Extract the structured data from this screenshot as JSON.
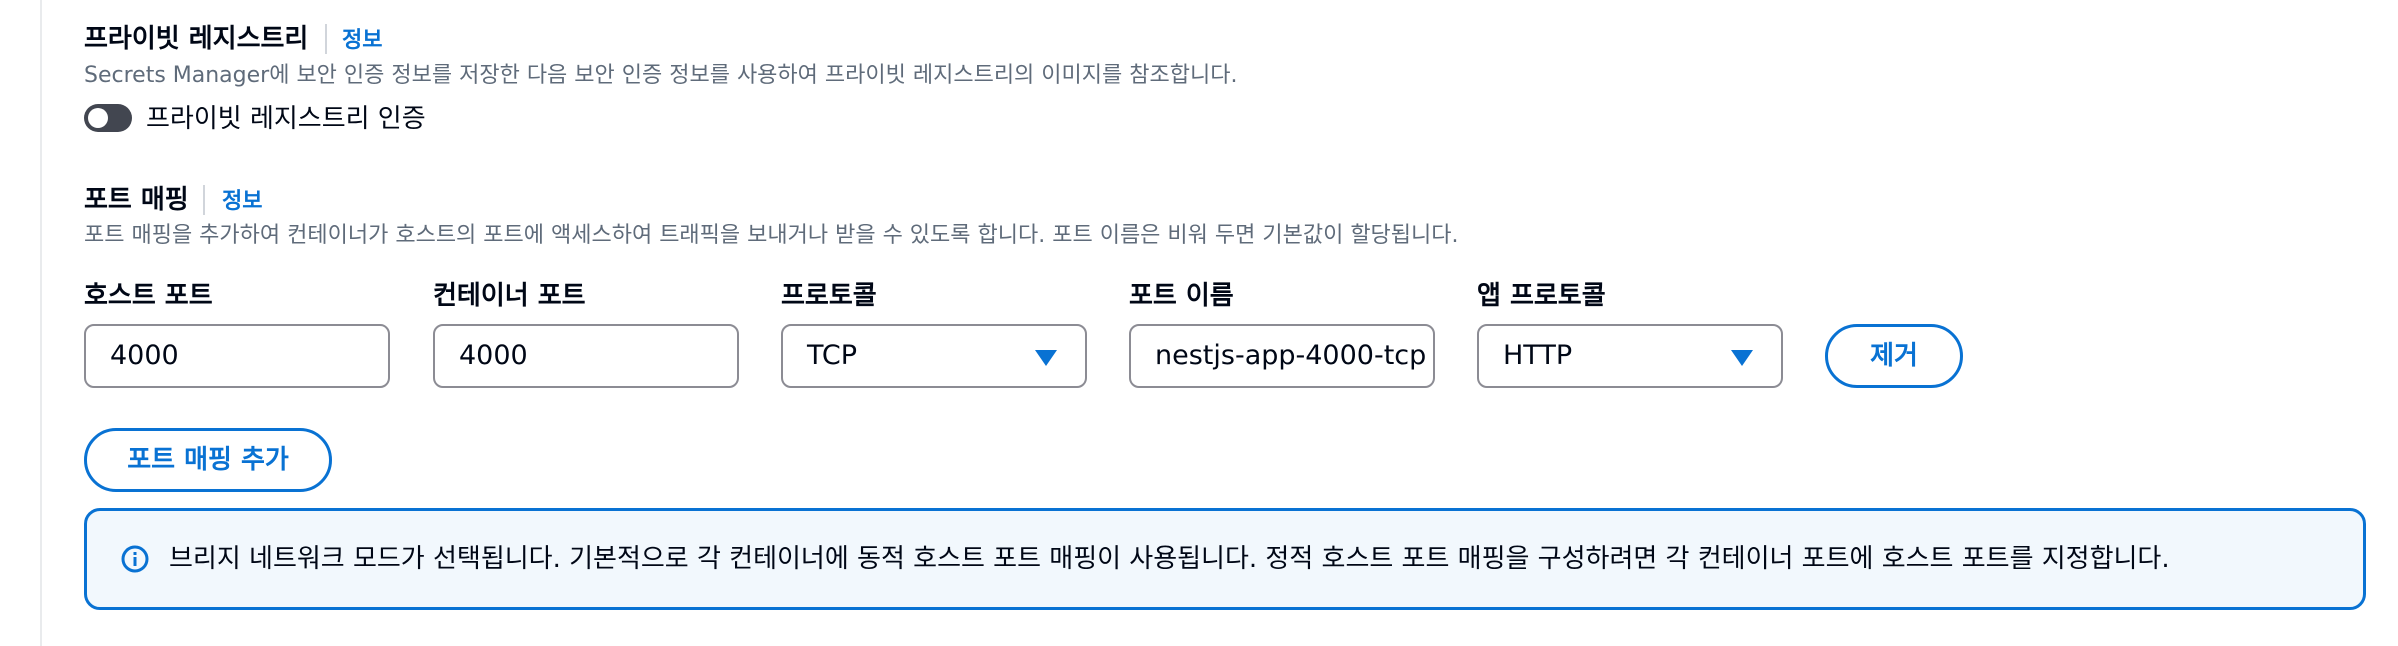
{
  "private_registry": {
    "title": "프라이빗 레지스트리",
    "info_link": "정보",
    "description": "Secrets Manager에 보안 인증 정보를 저장한 다음 보안 인증 정보를 사용하여 프라이빗 레지스트리의 이미지를 참조합니다.",
    "toggle_label": "프라이빗 레지스트리 인증",
    "toggle_on": false
  },
  "port_mapping": {
    "title": "포트 매핑",
    "info_link": "정보",
    "description": "포트 매핑을 추가하여 컨테이너가 호스트의 포트에 액세스하여 트래픽을 보내거나 받을 수 있도록 합니다. 포트 이름은 비워 두면 기본값이 할당됩니다.",
    "fields": {
      "host_port": {
        "label": "호스트 포트",
        "value": "4000"
      },
      "container_port": {
        "label": "컨테이너 포트",
        "value": "4000"
      },
      "protocol": {
        "label": "프로토콜",
        "value": "TCP"
      },
      "port_name": {
        "label": "포트 이름",
        "value": "nestjs-app-4000-tcp"
      },
      "app_protocol": {
        "label": "앱 프로토콜",
        "value": "HTTP"
      }
    },
    "remove_button": "제거",
    "add_button": "포트 매핑 추가"
  },
  "alert": {
    "icon": "info-icon",
    "text": "브리지 네트워크 모드가 선택됩니다. 기본적으로 각 컨테이너에 동적 호스트 포트 매핑이 사용됩니다. 정적 호스트 포트 매핑을 구성하려면 각 컨테이너 포트에 호스트 포트를 지정합니다."
  },
  "colors": {
    "accent": "#0972d3",
    "text": "#000716",
    "muted": "#5f6b7a",
    "alert_bg": "#f2f8fd",
    "toggle_off": "#424650"
  }
}
